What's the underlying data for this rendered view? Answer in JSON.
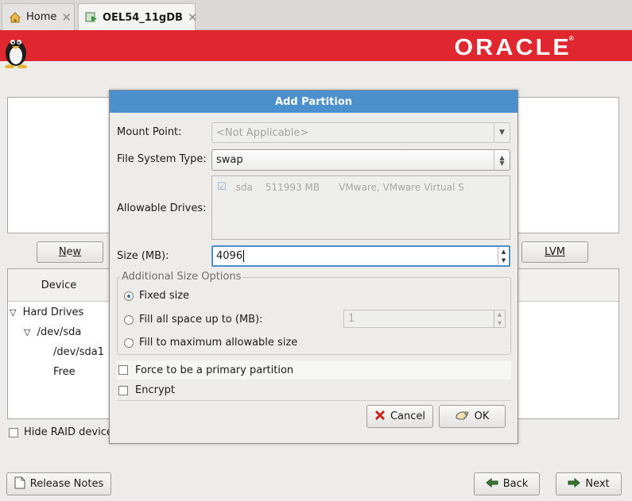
{
  "tabs": [
    {
      "label": "Home",
      "close": "✕"
    },
    {
      "label": "OEL54_11gDB",
      "close": "✕"
    }
  ],
  "banner": {
    "brand": "ORACLE",
    "mark": "®",
    "color": "#e0262e"
  },
  "background": {
    "buttons": {
      "new": "New",
      "lvm": "LVM",
      "release_notes": "Release Notes",
      "back": "Back",
      "next": "Next"
    },
    "table_header": "Device",
    "tree": [
      {
        "label": "Hard Drives",
        "expander": "▽"
      },
      {
        "label": "/dev/sda",
        "expander": "▽"
      },
      {
        "label": "/dev/sda1"
      },
      {
        "label": "Free"
      }
    ],
    "hide_raid_label": "Hide RAID device"
  },
  "dialog": {
    "title": "Add Partition",
    "accent": "#4b8fcc",
    "mount_point": {
      "label": "Mount Point:",
      "value": "<Not Applicable>"
    },
    "fs_type": {
      "label": "File System Type:",
      "value": "swap"
    },
    "allowable_drives": {
      "label": "Allowable Drives:",
      "drive": {
        "name": "sda",
        "size": "511993 MB",
        "model": "VMware, VMware Virtual S",
        "checked": true
      }
    },
    "size": {
      "label": "Size (MB):",
      "value": "4096"
    },
    "additional_options": {
      "legend": "Additional Size Options",
      "fixed": "Fixed size",
      "fill_up_to": "Fill all space up to (MB):",
      "fill_up_to_value": "1",
      "fill_max": "Fill to maximum allowable size",
      "selected": "fixed"
    },
    "force_primary": "Force to be a primary partition",
    "encrypt": "Encrypt",
    "cancel": "Cancel",
    "ok": "OK"
  }
}
